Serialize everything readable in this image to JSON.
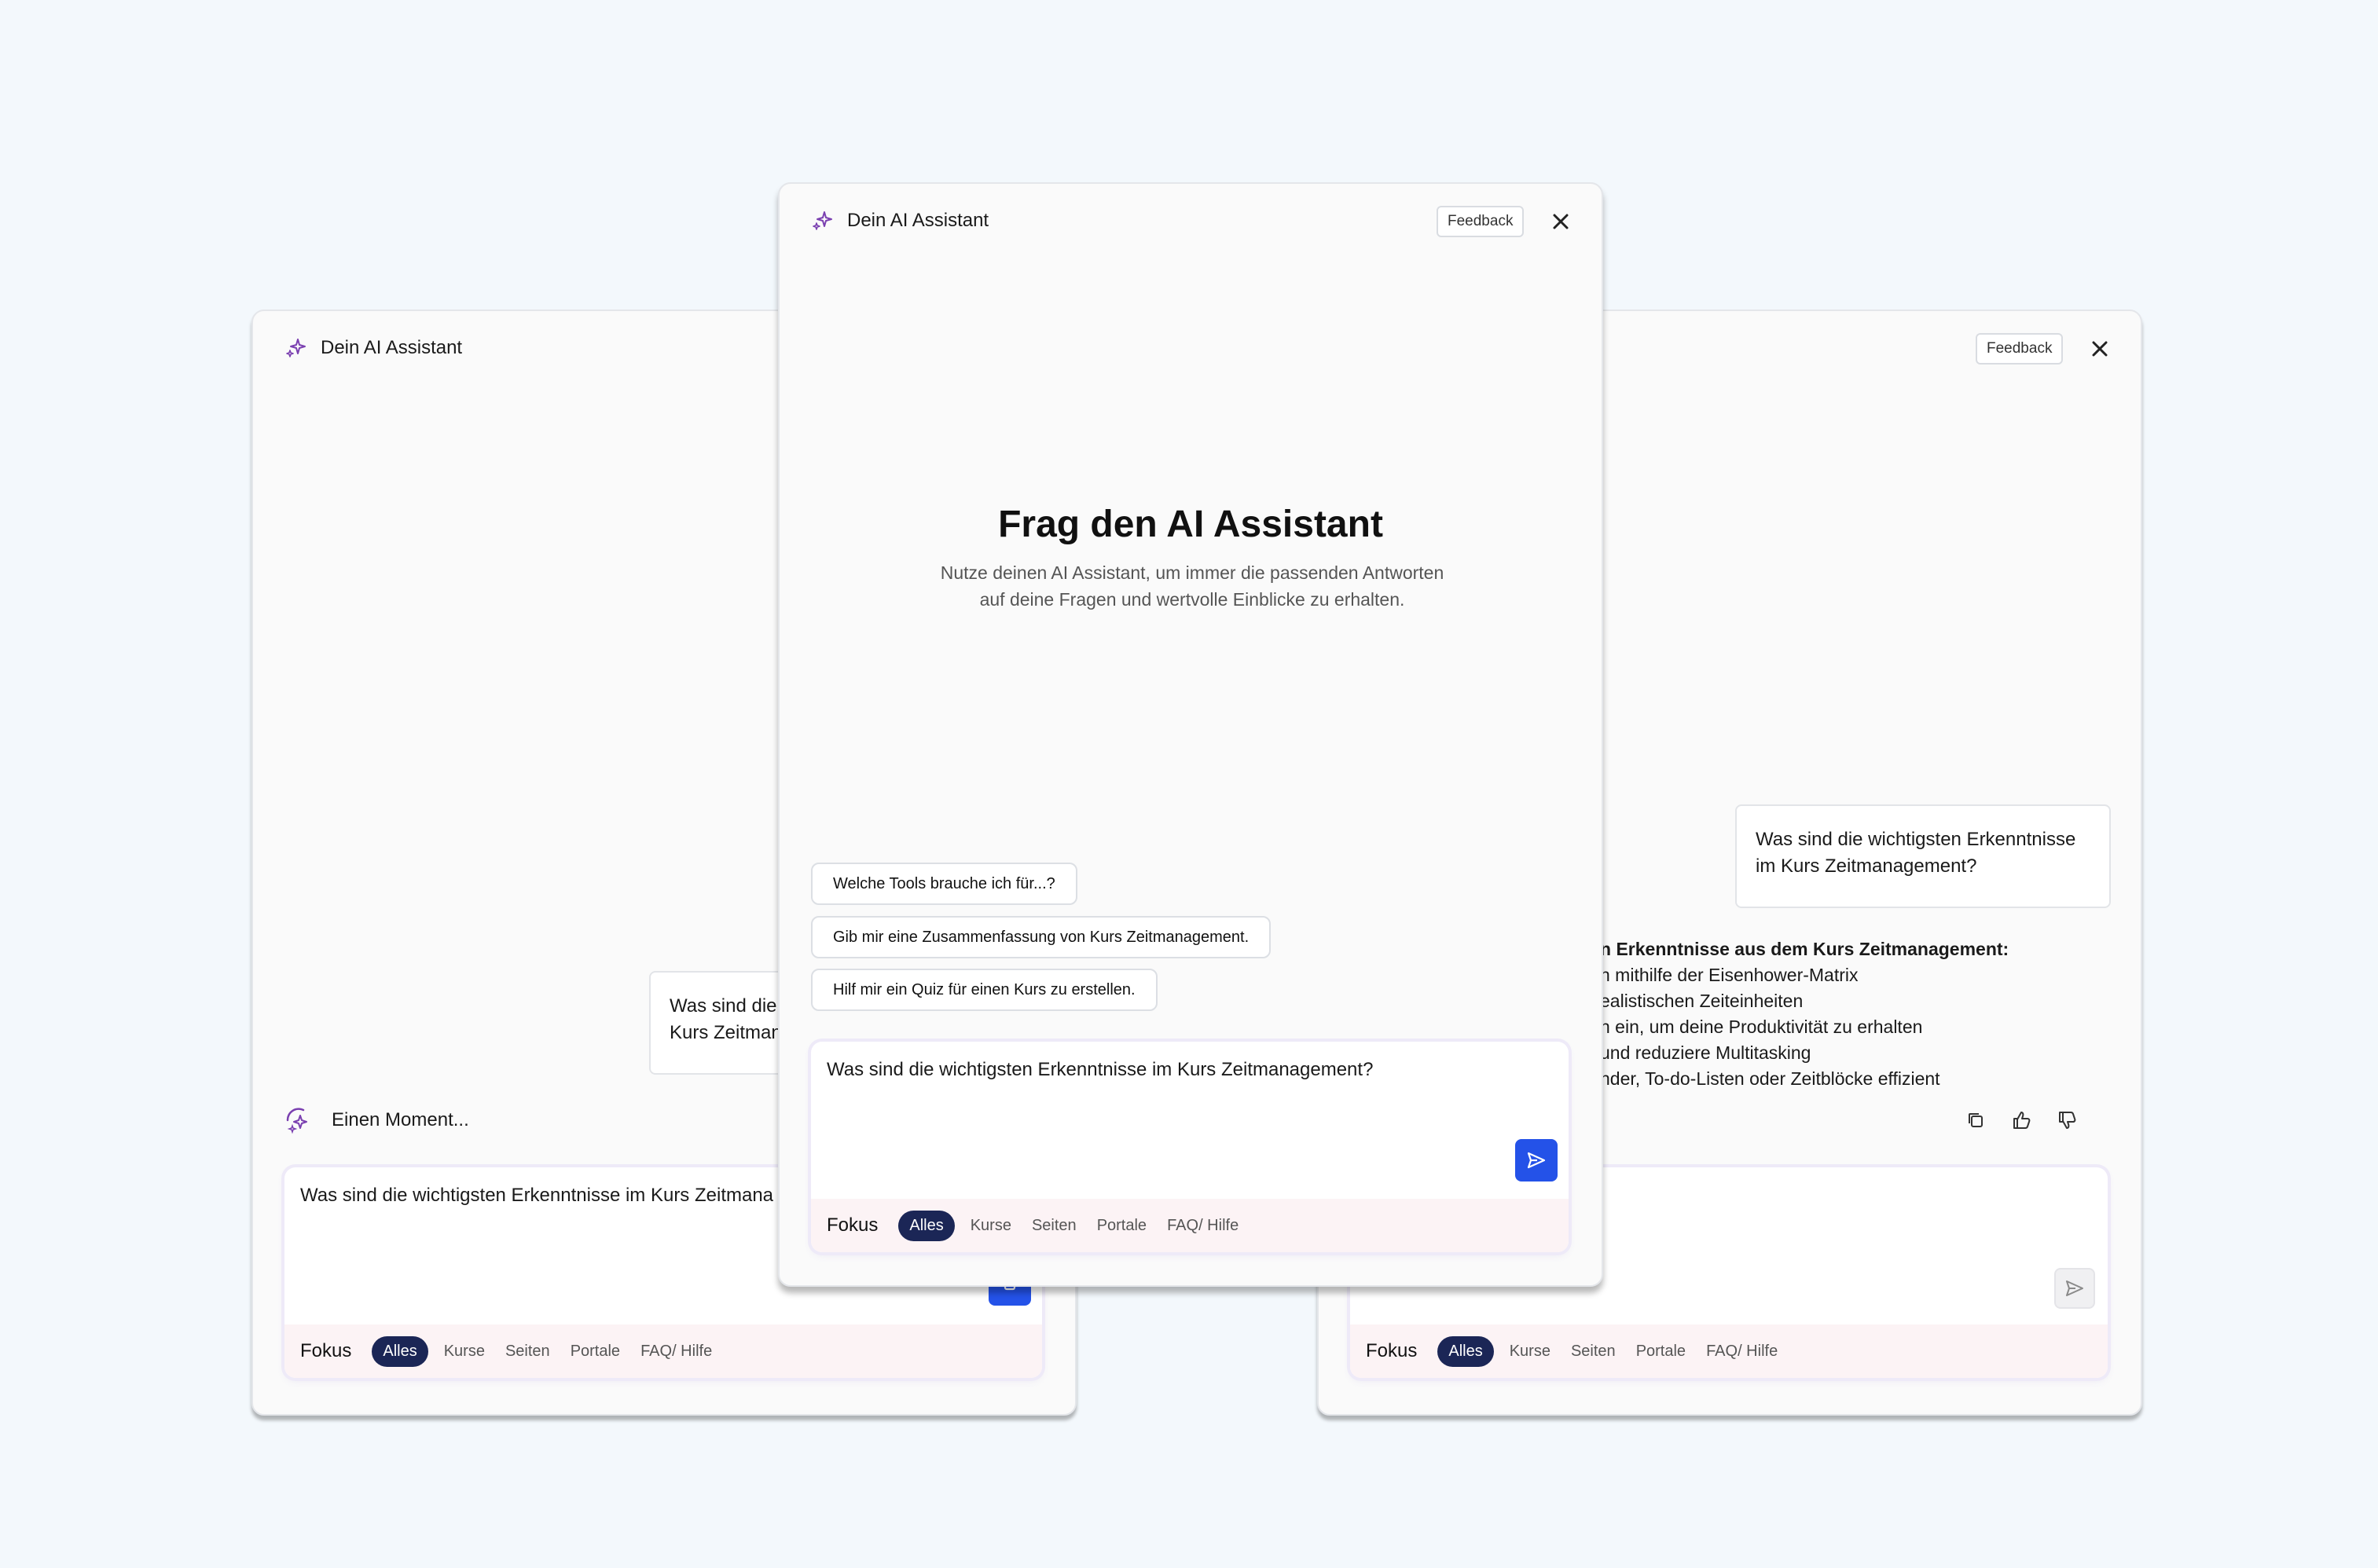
{
  "assistant_title": "Dein AI Assistant",
  "feedback_label": "Feedback",
  "center": {
    "heading": "Frag den AI Assistant",
    "subtext_line1": "Nutze deinen AI Assistant, um immer die passenden Antworten",
    "subtext_line2": "auf deine Fragen und wertvolle Einblicke zu erhalten.",
    "suggestions": [
      "Welche Tools brauche ich für...?",
      "Gib mir eine Zusammenfassung von Kurs Zeitmanagement.",
      "Hilf mir ein Quiz für einen Kurs zu erstellen."
    ],
    "input_value": "Was sind die wichtigsten Erkenntnisse im Kurs Zeitmanagement?"
  },
  "focus": {
    "label": "Fokus",
    "chips": [
      "Alles",
      "Kurse",
      "Seiten",
      "Portale",
      "FAQ/ Hilfe"
    ],
    "selected": "Alles"
  },
  "left": {
    "bubble_line1": "Was sind die",
    "bubble_line2": "Kurs Zeitman",
    "loading_text": "Einen Moment...",
    "input_value": "Was sind die wichtigsten Erkenntnisse im Kurs Zeitmana"
  },
  "right": {
    "bubble_line1": "Was sind die wichtigsten Erkenntnisse",
    "bubble_line2": "im Kurs Zeitmanagement?",
    "answer_heading": "n Erkenntnisse aus dem Kurs Zeitmanagement:",
    "answer_lines": [
      "n mithilfe der Eisenhower-Matrix",
      "ealistischen Zeiteinheiten",
      "n ein, um deine Produktivität zu erhalten",
      "und reduziere Multitasking",
      "nder, To-do-Listen oder Zeitblöcke effizient"
    ]
  },
  "colors": {
    "background": "#f3f8fc",
    "send_active": "#2452e8",
    "chip_selected": "#1b2656",
    "sparkle": "#7a3fb0"
  },
  "icons": [
    "sparkle-icon",
    "close-icon",
    "send-icon",
    "copy-icon",
    "thumbs-up-icon",
    "thumbs-down-icon",
    "loading-sparkle-icon"
  ]
}
